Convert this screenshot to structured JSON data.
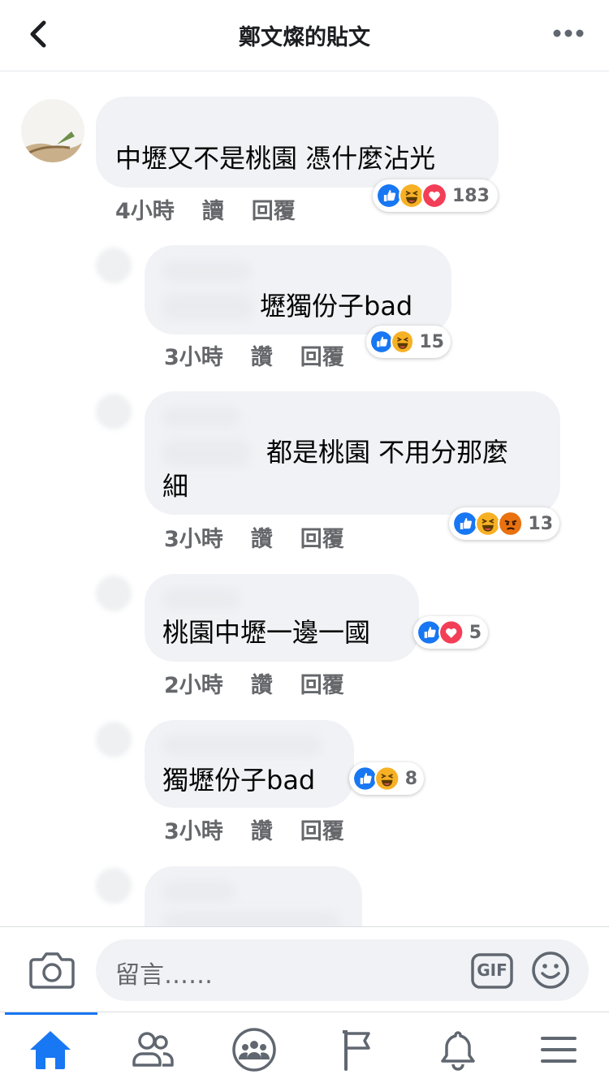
{
  "header": {
    "title": "鄭文燦的貼文",
    "back_icon": "chevron-left-icon",
    "more_icon": "more-horizontal-icon"
  },
  "comments": [
    {
      "text": "中壢又不是桃園 憑什麼沾光",
      "time": "4小時",
      "like_label": "讀",
      "reply_label": "回覆",
      "reactions": [
        "like",
        "haha",
        "love"
      ],
      "reaction_count": "183"
    },
    {
      "text": "壢獨份子bad",
      "time": "3小時",
      "like_label": "讚",
      "reply_label": "回覆",
      "reactions": [
        "like",
        "haha"
      ],
      "reaction_count": "15"
    },
    {
      "text_line1": "都是桃園 不用分那麼",
      "text_line2": "細",
      "time": "3小時",
      "like_label": "讚",
      "reply_label": "回覆",
      "reactions": [
        "like",
        "haha",
        "angry"
      ],
      "reaction_count": "13"
    },
    {
      "text": "桃園中壢一邊一國",
      "time": "2小時",
      "like_label": "讚",
      "reply_label": "回覆",
      "reactions": [
        "like",
        "love"
      ],
      "reaction_count": "5"
    },
    {
      "text": "獨壢份子bad",
      "time": "3小時",
      "like_label": "讚",
      "reply_label": "回覆",
      "reactions": [
        "like",
        "haha"
      ],
      "reaction_count": "8"
    }
  ],
  "composer": {
    "placeholder": "留言……",
    "camera_icon": "camera-icon",
    "gif_label": "GIF",
    "emoji_icon": "smiley-icon"
  },
  "nav": {
    "items": [
      "home-icon",
      "friends-icon",
      "groups-icon",
      "pages-flag-icon",
      "notifications-bell-icon",
      "menu-icon"
    ],
    "active_color": "#1877f2",
    "inactive_color": "#606770"
  },
  "colors": {
    "like": "#1877f2",
    "love": "#f33e58",
    "haha": "#f7b125",
    "angry": "#e9710f",
    "bubble": "#f0f2f5"
  }
}
